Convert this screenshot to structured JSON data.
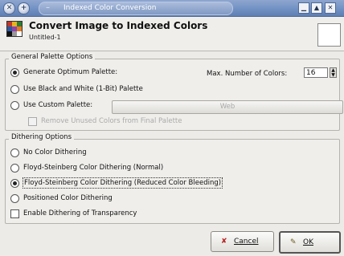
{
  "window": {
    "title": "Indexed Color Conversion",
    "left_buttons": [
      "close",
      "menu"
    ],
    "right_buttons": [
      "minimize",
      "maximize",
      "close"
    ]
  },
  "header": {
    "heading": "Convert Image to Indexed Colors",
    "image_name": "Untitled-1"
  },
  "palette_options": {
    "title": "General Palette Options",
    "generate_optimum": {
      "label": "Generate Optimum Palette:",
      "selected": true
    },
    "max_colors_label": "Max. Number of Colors:",
    "max_colors_value": "16",
    "black_white": {
      "label": "Use Black and White (1-Bit) Palette",
      "selected": false
    },
    "custom": {
      "label": "Use Custom Palette:",
      "selected": false,
      "palette_value": "Web"
    },
    "remove_unused": {
      "label": "Remove Unused Colors from Final Palette",
      "checked": false,
      "disabled": true
    }
  },
  "dithering_options": {
    "title": "Dithering Options",
    "choices": [
      {
        "label": "No Color Dithering",
        "selected": false
      },
      {
        "label": "Floyd-Steinberg Color Dithering (Normal)",
        "selected": false
      },
      {
        "label": "Floyd-Steinberg Color Dithering (Reduced Color Bleeding)",
        "selected": true
      },
      {
        "label": "Positioned Color Dithering",
        "selected": false
      }
    ],
    "transparency": {
      "label": "Enable Dithering of Transparency",
      "checked": false
    }
  },
  "buttons": {
    "cancel": "Cancel",
    "ok": "OK"
  },
  "colors": {
    "titlebar": "#6f8fc2",
    "background": "#ecebe8"
  }
}
